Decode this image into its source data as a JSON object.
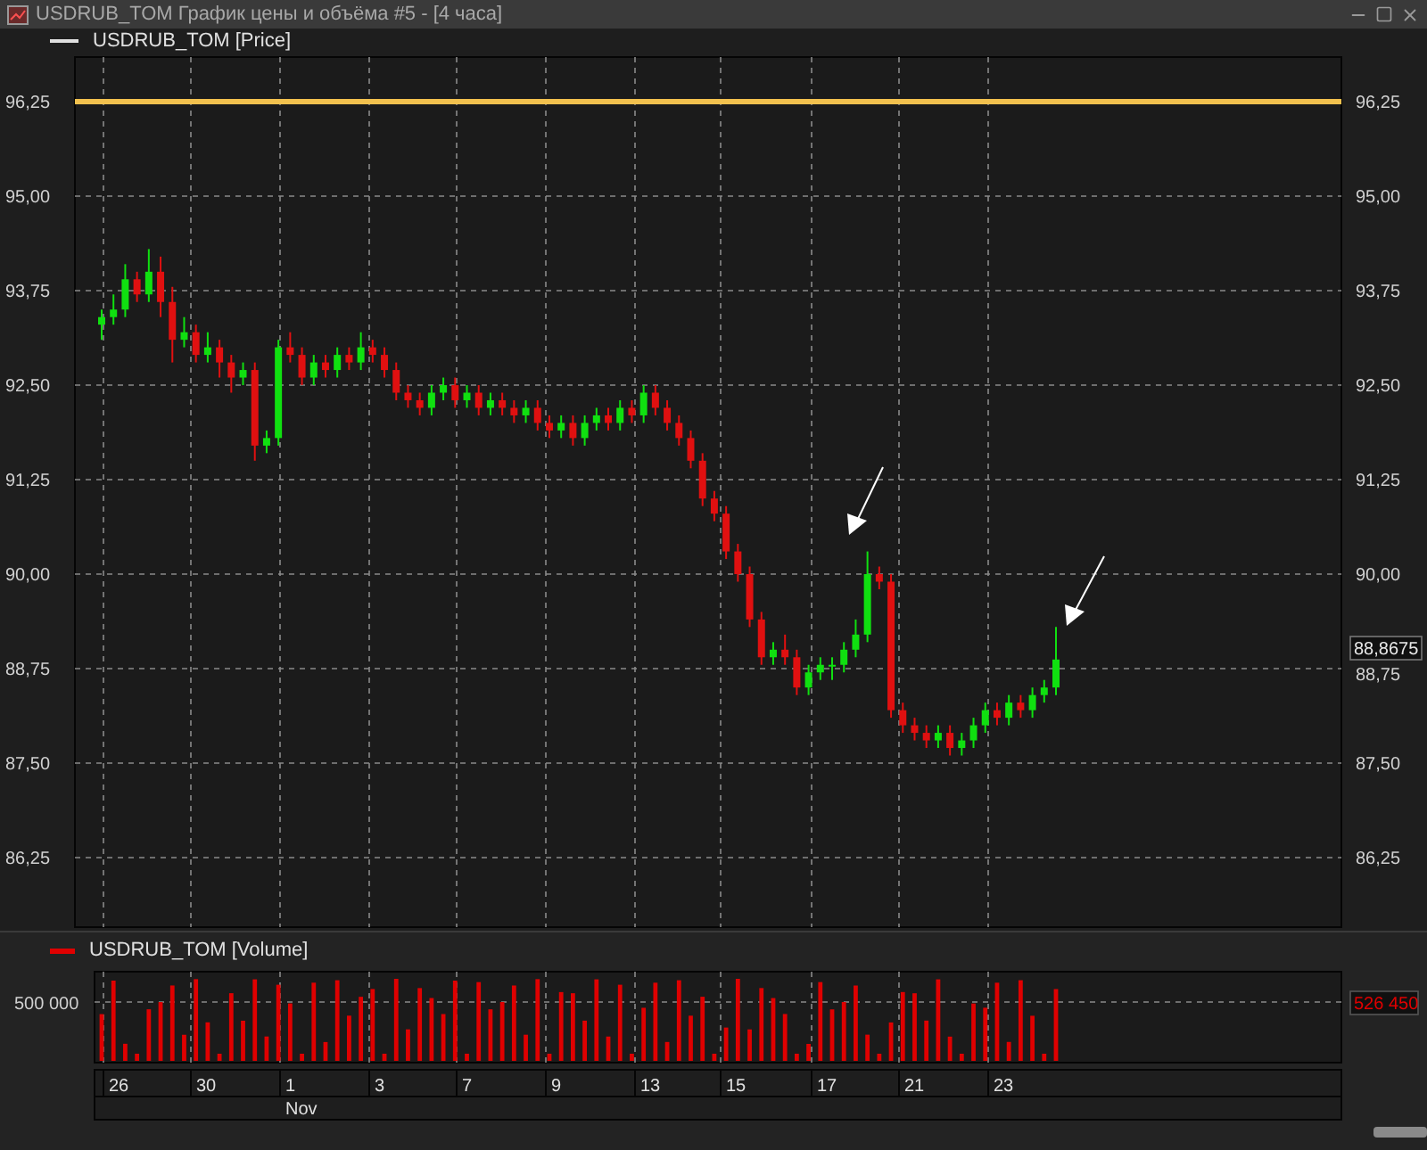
{
  "window": {
    "title": "USDRUB_TOM График цены и объёма #5 - [4 часа]"
  },
  "price_panel": {
    "legend": "USDRUB_TOM [Price]",
    "chart_data": {
      "type": "candlestick",
      "ylim": [
        85.33,
        96.84
      ],
      "grid": true,
      "ref_lines": [
        {
          "axis": "y",
          "value": 96.25,
          "color": "#f2c14e"
        }
      ],
      "yticks": [
        {
          "value": 96.25,
          "label": "96,25"
        },
        {
          "value": 95.0,
          "label": "95,00"
        },
        {
          "value": 93.75,
          "label": "93,75"
        },
        {
          "value": 92.5,
          "label": "92,50"
        },
        {
          "value": 91.25,
          "label": "91,25"
        },
        {
          "value": 90.0,
          "label": "90,00"
        },
        {
          "value": 88.75,
          "label": "88,75"
        },
        {
          "value": 87.5,
          "label": "87,50"
        },
        {
          "value": 86.25,
          "label": "86,25"
        }
      ],
      "categories": [
        null,
        null,
        null,
        null,
        null,
        null,
        null,
        null,
        null,
        null,
        null,
        null,
        null,
        null,
        null,
        null,
        null,
        null,
        null,
        null,
        null,
        null,
        null,
        null,
        null,
        null,
        null,
        null,
        null,
        null,
        null,
        null,
        null,
        null,
        null,
        null,
        null,
        null,
        null,
        null,
        null,
        null,
        null,
        null,
        null,
        null,
        null,
        null,
        null,
        null,
        null,
        null,
        null,
        null,
        null,
        null,
        null,
        null,
        null,
        null,
        null,
        null,
        null,
        null,
        null,
        null,
        null,
        null,
        null,
        null,
        null,
        null,
        null,
        null,
        null,
        null,
        null,
        null,
        null,
        null,
        null,
        null
      ],
      "ohlc": [
        [
          93.3,
          93.5,
          93.1,
          93.4
        ],
        [
          93.4,
          93.7,
          93.3,
          93.5
        ],
        [
          93.5,
          94.1,
          93.4,
          93.9
        ],
        [
          93.9,
          94.0,
          93.6,
          93.7
        ],
        [
          93.7,
          94.3,
          93.6,
          94.0
        ],
        [
          94.0,
          94.2,
          93.4,
          93.6
        ],
        [
          93.6,
          93.8,
          92.8,
          93.1
        ],
        [
          93.1,
          93.4,
          93.0,
          93.2
        ],
        [
          93.2,
          93.3,
          92.8,
          92.9
        ],
        [
          92.9,
          93.2,
          92.8,
          93.0
        ],
        [
          93.0,
          93.1,
          92.6,
          92.8
        ],
        [
          92.8,
          92.9,
          92.4,
          92.6
        ],
        [
          92.6,
          92.8,
          92.5,
          92.7
        ],
        [
          92.7,
          92.8,
          91.5,
          91.7
        ],
        [
          91.7,
          91.9,
          91.6,
          91.8
        ],
        [
          91.8,
          93.1,
          91.7,
          93.0
        ],
        [
          93.0,
          93.2,
          92.8,
          92.9
        ],
        [
          92.9,
          93.0,
          92.5,
          92.6
        ],
        [
          92.6,
          92.9,
          92.5,
          92.8
        ],
        [
          92.8,
          92.9,
          92.6,
          92.7
        ],
        [
          92.7,
          93.0,
          92.6,
          92.9
        ],
        [
          92.9,
          93.0,
          92.7,
          92.8
        ],
        [
          92.8,
          93.2,
          92.7,
          93.0
        ],
        [
          93.0,
          93.1,
          92.8,
          92.9
        ],
        [
          92.9,
          93.0,
          92.6,
          92.7
        ],
        [
          92.7,
          92.8,
          92.3,
          92.4
        ],
        [
          92.4,
          92.5,
          92.2,
          92.3
        ],
        [
          92.3,
          92.4,
          92.1,
          92.2
        ],
        [
          92.2,
          92.5,
          92.1,
          92.4
        ],
        [
          92.4,
          92.6,
          92.3,
          92.5
        ],
        [
          92.5,
          92.6,
          92.2,
          92.3
        ],
        [
          92.3,
          92.5,
          92.2,
          92.4
        ],
        [
          92.4,
          92.5,
          92.1,
          92.2
        ],
        [
          92.2,
          92.4,
          92.1,
          92.3
        ],
        [
          92.3,
          92.4,
          92.1,
          92.2
        ],
        [
          92.2,
          92.3,
          92.0,
          92.1
        ],
        [
          92.1,
          92.3,
          92.0,
          92.2
        ],
        [
          92.2,
          92.3,
          91.9,
          92.0
        ],
        [
          92.0,
          92.1,
          91.8,
          91.9
        ],
        [
          91.9,
          92.1,
          91.8,
          92.0
        ],
        [
          92.0,
          92.1,
          91.7,
          91.8
        ],
        [
          91.8,
          92.1,
          91.7,
          92.0
        ],
        [
          92.0,
          92.2,
          91.9,
          92.1
        ],
        [
          92.1,
          92.2,
          91.9,
          92.0
        ],
        [
          92.0,
          92.3,
          91.9,
          92.2
        ],
        [
          92.2,
          92.3,
          92.0,
          92.1
        ],
        [
          92.1,
          92.5,
          92.0,
          92.4
        ],
        [
          92.4,
          92.5,
          92.1,
          92.2
        ],
        [
          92.2,
          92.3,
          91.9,
          92.0
        ],
        [
          92.0,
          92.1,
          91.7,
          91.8
        ],
        [
          91.8,
          91.9,
          91.4,
          91.5
        ],
        [
          91.5,
          91.6,
          90.9,
          91.0
        ],
        [
          91.0,
          91.1,
          90.7,
          90.8
        ],
        [
          90.8,
          90.9,
          90.2,
          90.3
        ],
        [
          90.3,
          90.4,
          89.9,
          90.0
        ],
        [
          90.0,
          90.1,
          89.3,
          89.4
        ],
        [
          89.4,
          89.5,
          88.8,
          88.9
        ],
        [
          88.9,
          89.1,
          88.8,
          89.0
        ],
        [
          89.0,
          89.2,
          88.8,
          88.9
        ],
        [
          88.9,
          89.0,
          88.4,
          88.5
        ],
        [
          88.5,
          88.8,
          88.4,
          88.7
        ],
        [
          88.7,
          88.9,
          88.6,
          88.8
        ],
        [
          88.8,
          88.9,
          88.6,
          88.8
        ],
        [
          88.8,
          89.1,
          88.7,
          89.0
        ],
        [
          89.0,
          89.4,
          88.9,
          89.2
        ],
        [
          89.2,
          90.3,
          89.1,
          90.0
        ],
        [
          90.0,
          90.1,
          89.8,
          89.9
        ],
        [
          89.9,
          90.0,
          88.1,
          88.2
        ],
        [
          88.2,
          88.3,
          87.9,
          88.0
        ],
        [
          88.0,
          88.1,
          87.8,
          87.9
        ],
        [
          87.9,
          88.0,
          87.7,
          87.8
        ],
        [
          87.8,
          88.0,
          87.7,
          87.9
        ],
        [
          87.9,
          88.0,
          87.6,
          87.7
        ],
        [
          87.7,
          87.9,
          87.6,
          87.8
        ],
        [
          87.8,
          88.1,
          87.7,
          88.0
        ],
        [
          88.0,
          88.3,
          87.9,
          88.2
        ],
        [
          88.2,
          88.3,
          88.0,
          88.1
        ],
        [
          88.1,
          88.4,
          88.0,
          88.3
        ],
        [
          88.3,
          88.4,
          88.1,
          88.2
        ],
        [
          88.2,
          88.5,
          88.1,
          88.4
        ],
        [
          88.4,
          88.6,
          88.3,
          88.5
        ],
        [
          88.5,
          89.3,
          88.4,
          88.87
        ]
      ]
    },
    "right_ticks": [
      "96,25",
      "95,00",
      "93,75",
      "92,50",
      "91,25",
      "90,00",
      "88,75",
      "87,50",
      "86,25"
    ],
    "last_price": "88,8675"
  },
  "volume_panel": {
    "legend": "USDRUB_TOM [Volume]",
    "left_tick": "500 000",
    "last_volume": "526 450"
  },
  "time_axis": {
    "dates": [
      {
        "label": "26"
      },
      {
        "label": "30"
      },
      {
        "label": "1",
        "month": "Nov"
      },
      {
        "label": "3"
      },
      {
        "label": "7"
      },
      {
        "label": "9"
      },
      {
        "label": "13"
      },
      {
        "label": "15"
      },
      {
        "label": "17"
      },
      {
        "label": "21"
      },
      {
        "label": "23"
      }
    ]
  }
}
